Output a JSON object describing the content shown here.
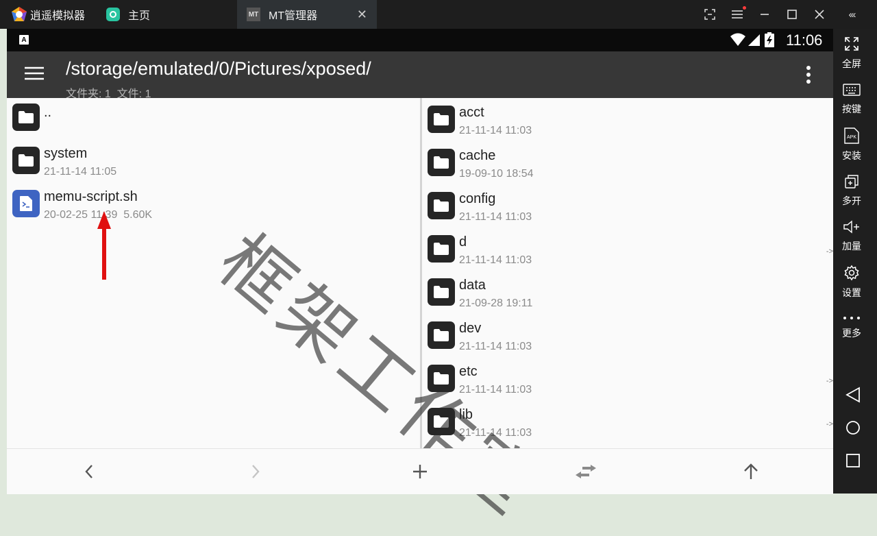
{
  "emulator": {
    "app_name": "逍遥模拟器",
    "home_tab": "主页",
    "active_tab": "MT管理器",
    "sidebar": {
      "fullscreen": "全屏",
      "keys": "按键",
      "install": "安装",
      "multi": "多开",
      "volume": "加量",
      "settings": "设置",
      "more": "更多"
    }
  },
  "statusbar": {
    "time": "11:06"
  },
  "toolbar": {
    "path": "/storage/emulated/0/Pictures/xposed/",
    "summary": "文件夹: 1  文件: 1"
  },
  "left_panel": {
    "items": [
      {
        "name": "..",
        "meta": "",
        "type": "folder"
      },
      {
        "name": "system",
        "meta": "21-11-14 11:05",
        "type": "folder"
      },
      {
        "name": "memu-script.sh",
        "meta": "20-02-25 11:39  5.60K",
        "type": "script"
      }
    ]
  },
  "right_panel": {
    "items": [
      {
        "name": "acct",
        "meta": "21-11-14 11:03",
        "link": false
      },
      {
        "name": "cache",
        "meta": "19-09-10 18:54",
        "link": false
      },
      {
        "name": "config",
        "meta": "21-11-14 11:03",
        "link": false
      },
      {
        "name": "d",
        "meta": "21-11-14 11:03",
        "link": true
      },
      {
        "name": "data",
        "meta": "21-09-28 19:11",
        "link": false
      },
      {
        "name": "dev",
        "meta": "21-11-14 11:03",
        "link": false
      },
      {
        "name": "etc",
        "meta": "21-11-14 11:03",
        "link": true
      },
      {
        "name": "lib",
        "meta": "21-11-14 11:03",
        "link": true
      }
    ],
    "link_marker": "->"
  },
  "watermark": "框架工作室",
  "colors": {
    "toolbar_bg": "#373737",
    "folder_icon": "#262626",
    "script_icon": "#3e64c2",
    "annotation_arrow": "#e01010"
  }
}
